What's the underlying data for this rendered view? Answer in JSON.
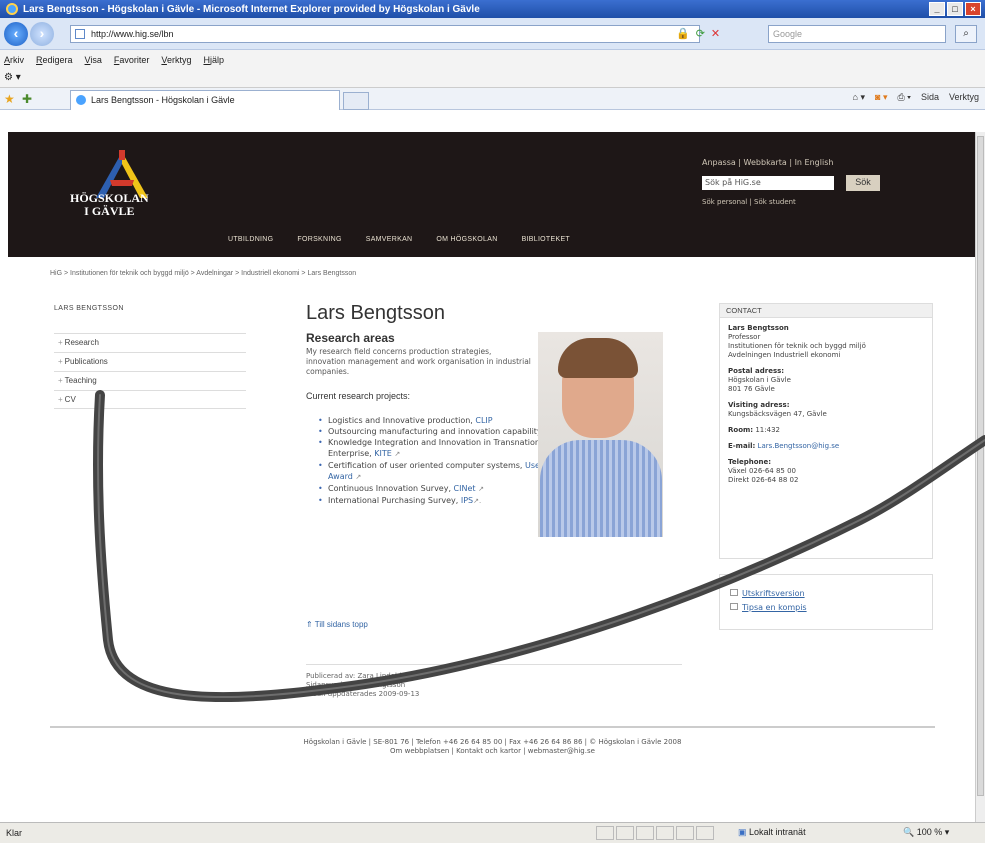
{
  "window": {
    "title": "Lars Bengtsson - Högskolan i Gävle - Microsoft Internet Explorer provided by Högskolan i Gävle",
    "buttons": [
      "_",
      "□",
      "×"
    ]
  },
  "browser": {
    "url": "http://www.hig.se/lbn",
    "search_placeholder": "Google",
    "menu": [
      "Arkiv",
      "Redigera",
      "Visa",
      "Favoriter",
      "Verktyg",
      "Hjälp"
    ],
    "tab_title": "Lars Bengtsson - Högskolan i Gävle",
    "cmd": {
      "page": "Sida",
      "tools": "Verktyg"
    }
  },
  "site": {
    "logo_line1": "HÖGSKOLAN",
    "logo_line2": "I GÄVLE",
    "util_links": "Anpassa  |  Webbkarta  |  In English",
    "search_value": "Sök på HiG.se",
    "search_button": "Sök",
    "sub_links": "Sök personal  |  Sök student",
    "nav": [
      "UTBILDNING",
      "FORSKNING",
      "SAMVERKAN",
      "OM HÖGSKOLAN",
      "BIBLIOTEKET"
    ],
    "breadcrumb": "HiG > Institutionen för teknik och byggd miljö > Avdelningar > Industriell ekonomi > Lars Bengtsson"
  },
  "left": {
    "title": "LARS BENGTSSON",
    "items": [
      "Research",
      "Publications",
      "Teaching",
      "CV"
    ]
  },
  "main": {
    "name": "Lars Bengtsson",
    "areas_heading": "Research areas",
    "areas_text": "My research field concerns production strategies, innovation management and work organisation in industrial companies.",
    "projects_heading": "Current research projects:",
    "projects": [
      {
        "text": "Logistics and Innovative production, ",
        "link": "CLIP",
        "ext": ""
      },
      {
        "text": "Outsourcing manufacturing and innovation capability",
        "link": "",
        "ext": ""
      },
      {
        "text": "Knowledge Integration and Innovation in Transnational Enterprise, ",
        "link": "KITE",
        "ext": "↗"
      },
      {
        "text": "Certification of user oriented computer systems, ",
        "link": "Users Award",
        "ext": "↗"
      },
      {
        "text": "Continuous Innovation Survey, ",
        "link": "CINet",
        "ext": "↗"
      },
      {
        "text": "International Purchasing Survey, ",
        "link": "IPS",
        "ext": "↗."
      }
    ],
    "to_top": "Till sidans topp",
    "published_by": "Publicerad av: Zara Lindahl",
    "owner": "Sidansvarig: Lars Bengtsson",
    "updated": "Sidan uppdaterades 2009-09-13"
  },
  "contact": {
    "heading": "CONTACT",
    "name": "Lars Bengtsson",
    "role": "Professor",
    "dept": "Institutionen för teknik och byggd miljö",
    "div": "Avdelningen Industriell ekonomi",
    "postal_label": "Postal adress:",
    "postal1": "Högskolan i Gävle",
    "postal2": "801 76 Gävle",
    "visiting_label": "Visiting adress:",
    "visiting": "Kungsbäcksvägen 47, Gävle",
    "room_label": "Room:",
    "room": "11:432",
    "email_label": "E-mail:",
    "email": "Lars.Bengtsson@hig.se",
    "tel_label": "Telephone:",
    "tel": "Växel 026-64 85 00",
    "direct": "Direkt 026-64 88 02"
  },
  "tools": {
    "print": "Utskriftsversion",
    "tip": "Tipsa en kompis"
  },
  "footer": {
    "line1": "Högskolan i Gävle | SE-801 76 | Telefon +46 26 64 85 00 | Fax +46 26 64 86 86 | © Högskolan i Gävle 2008",
    "line2": "Om webbplatsen | Kontakt och kartor | webmaster@hig.se"
  },
  "status": {
    "text": "Klar",
    "zone": "Lokalt intranät",
    "zoom": "100 %"
  }
}
